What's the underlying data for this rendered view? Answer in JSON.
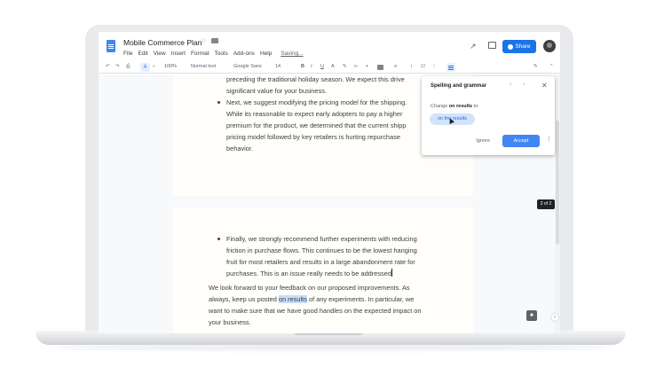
{
  "doc": {
    "title": "Mobile Commerce Plan",
    "star": "☆",
    "menu": [
      "File",
      "Edit",
      "View",
      "Insert",
      "Format",
      "Tools",
      "Add-ons",
      "Help"
    ],
    "saving": "Saving...",
    "share_label": "Share"
  },
  "toolbar": {
    "undo": "↶",
    "redo": "↷",
    "print": "⎙",
    "spellcheck": "A",
    "paint": "⌐",
    "zoom": "100%",
    "style": "Normal text",
    "font": "Google Sans",
    "size": "14",
    "bold": "B",
    "italic": "I",
    "underline": "U",
    "color": "A",
    "link": "∞",
    "comment": "+",
    "align": "≡",
    "spacing": "↕",
    "checklist": "☑",
    "bullets": "⁝",
    "edit_mode": "✎",
    "collapse": "⌃"
  },
  "page1": {
    "lead": [
      "preceding the traditional holiday season. We expect this drive",
      "significant value for your business."
    ],
    "bullet": [
      "Next, we suggest modifying the pricing model for the shipping.",
      "While its reasonable to expect early adopters to pay a higher",
      "premium for the product, we determined that the current shipp",
      "pricing model followed by key retailers is hurting repurchase",
      "behavior."
    ]
  },
  "page2": {
    "bullet": [
      "Finally, we strongly recommend further experiments with reducing",
      "friction in purchase flows. This continues to be the lowest hanging",
      "fruit for most retailers and results in a large abandonment rate for",
      "purchases. This is an issue really needs to be addressed"
    ],
    "para": {
      "line1": "We look forward to your feedback on our proposed improvements. As",
      "line2_before": "always, keep us posted ",
      "line2_highlight": "on results",
      "line2_after": " of any experiments. In particular, we",
      "line3": "want to make sure that we have good handles on the expected impact on",
      "line4": "your business."
    }
  },
  "panel": {
    "title": "Spelling and grammar",
    "prev": "‹",
    "next": "›",
    "close": "✕",
    "change_prefix": "Change ",
    "change_word": "on results",
    "change_suffix": " to:",
    "suggestion": "on the results",
    "ignore": "Ignore",
    "accept": "Accept",
    "more": "⋮"
  },
  "page_indicator": "2 of 2",
  "explore": "✦",
  "side_toggle": "›"
}
